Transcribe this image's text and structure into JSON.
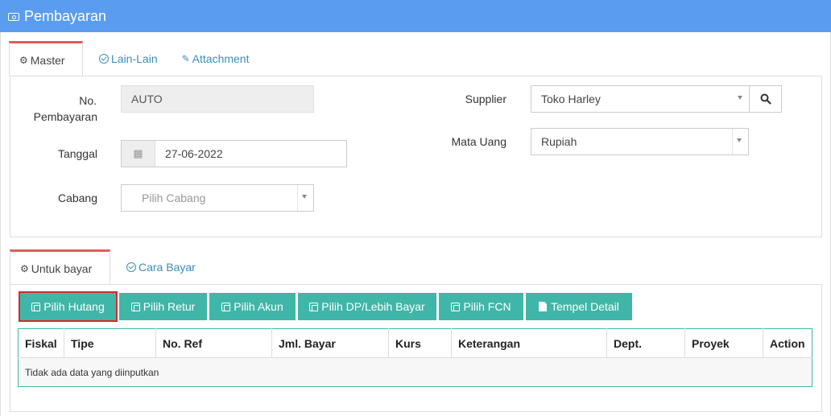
{
  "window": {
    "title": "Pembayaran",
    "icon": "money-icon"
  },
  "master_tabs": [
    {
      "label": "Master",
      "icon": "cogs-icon",
      "active": true
    },
    {
      "label": "Lain-Lain",
      "icon": "check-circle-icon",
      "active": false
    },
    {
      "label": "Attachment",
      "icon": "paperclip-icon",
      "active": false
    }
  ],
  "form": {
    "no_pembayaran": {
      "label": "No. Pembayaran",
      "label_line1": "No.",
      "label_line2": "Pembayaran",
      "value": "AUTO"
    },
    "tanggal": {
      "label": "Tanggal",
      "value": "27-06-2022",
      "icon": "calendar-icon"
    },
    "cabang": {
      "label": "Cabang",
      "placeholder": "Pilih Cabang"
    },
    "supplier": {
      "label": "Supplier",
      "value": "Toko Harley",
      "search_icon": "search-icon"
    },
    "mata_uang": {
      "label": "Mata Uang",
      "value": "Rupiah"
    }
  },
  "detail_tabs": [
    {
      "label": "Untuk bayar",
      "icon": "cogs-icon",
      "active": true
    },
    {
      "label": "Cara Bayar",
      "icon": "check-circle-icon",
      "active": false
    }
  ],
  "actions": [
    {
      "label": "Pilih Hutang",
      "icon": "copy-icon",
      "selected": true
    },
    {
      "label": "Pilih Retur",
      "icon": "copy-icon",
      "selected": false
    },
    {
      "label": "Pilih Akun",
      "icon": "copy-icon",
      "selected": false
    },
    {
      "label": "Pilih DP/Lebih Bayar",
      "icon": "copy-icon",
      "selected": false
    },
    {
      "label": "Pilih FCN",
      "icon": "copy-icon",
      "selected": false
    },
    {
      "label": "Tempel Detail",
      "icon": "paste-icon",
      "selected": false
    }
  ],
  "table": {
    "columns": [
      "Fiskal",
      "Tipe",
      "No. Ref",
      "Jml. Bayar",
      "Kurs",
      "Keterangan",
      "Dept.",
      "Proyek",
      "Action"
    ],
    "empty_message": "Tidak ada data yang diinputkan"
  },
  "colors": {
    "header": "#5a9cf0",
    "button": "#3fb6a8",
    "active_tab_border": "#e35b5a",
    "selected_outline": "#d42a2a"
  }
}
